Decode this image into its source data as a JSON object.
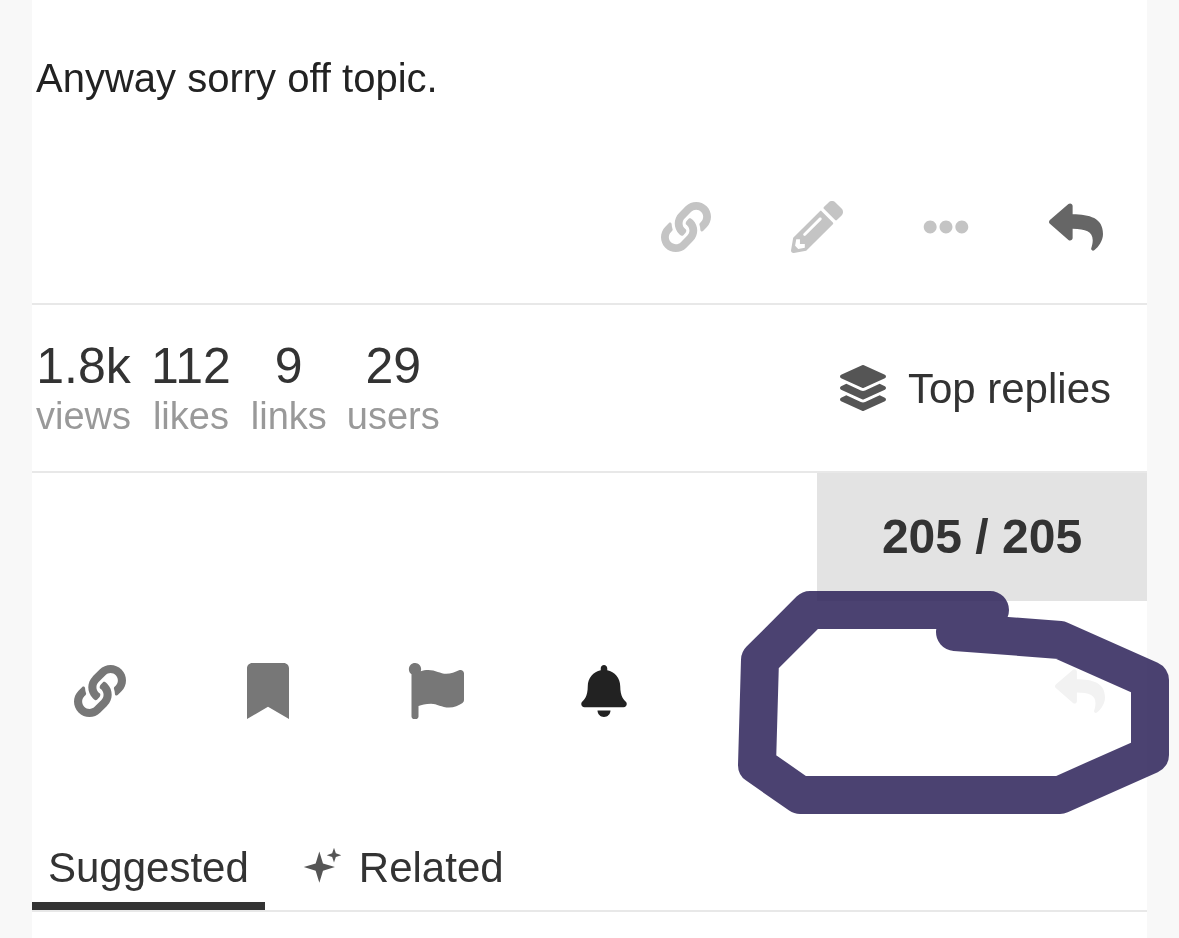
{
  "post": {
    "text": "Anyway sorry off topic."
  },
  "stats": [
    {
      "value": "1.8k",
      "label": "views"
    },
    {
      "value": "112",
      "label": "likes"
    },
    {
      "value": "9",
      "label": "links"
    },
    {
      "value": "29",
      "label": "users"
    }
  ],
  "top_replies": {
    "label": "Top replies"
  },
  "progress": {
    "text": "205 / 205"
  },
  "tabs": [
    {
      "label": "Suggested",
      "selected": true
    },
    {
      "label": "Related",
      "selected": false
    }
  ]
}
